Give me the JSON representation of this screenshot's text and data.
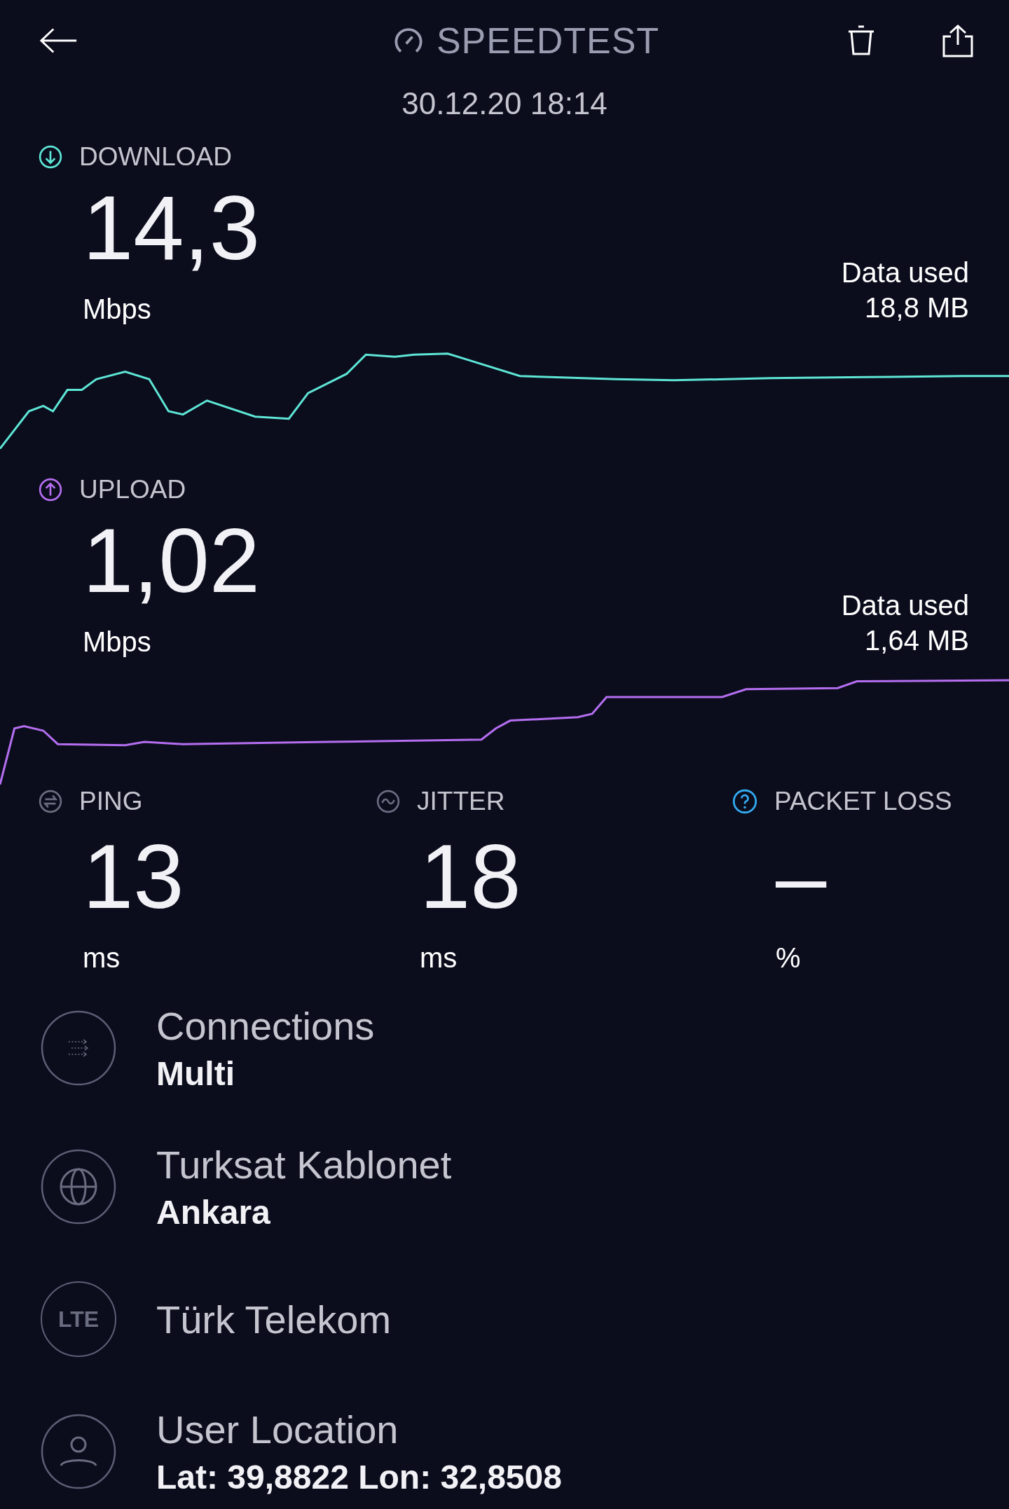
{
  "header": {
    "title": "SPEEDTEST",
    "datetime": "30.12.20 18:14"
  },
  "speeds": [
    {
      "kind": "download",
      "label": "DOWNLOAD",
      "value": "14,3",
      "unit": "Mbps",
      "data_used_label": "Data used",
      "data_used": "18,8 MB",
      "color": "#5ee6d6"
    },
    {
      "kind": "upload",
      "label": "UPLOAD",
      "value": "1,02",
      "unit": "Mbps",
      "data_used_label": "Data used",
      "data_used": "1,64 MB",
      "color": "#b56ef0"
    }
  ],
  "metrics": [
    {
      "kind": "ping",
      "label": "PING",
      "value": "13",
      "unit": "ms"
    },
    {
      "kind": "jitter",
      "label": "JITTER",
      "value": "18",
      "unit": "ms"
    },
    {
      "kind": "packet_loss",
      "label": "PACKET LOSS",
      "value": "–",
      "unit": "%"
    }
  ],
  "details": [
    {
      "kind": "connections",
      "title": "Connections",
      "value": "Multi"
    },
    {
      "kind": "server",
      "title": "Turksat Kablonet",
      "value": "Ankara"
    },
    {
      "kind": "network",
      "icon_text": "LTE",
      "title": "Türk Telekom"
    },
    {
      "kind": "location",
      "title": "User Location",
      "value": "Lat: 39,8822 Lon: 32,8508"
    }
  ]
}
